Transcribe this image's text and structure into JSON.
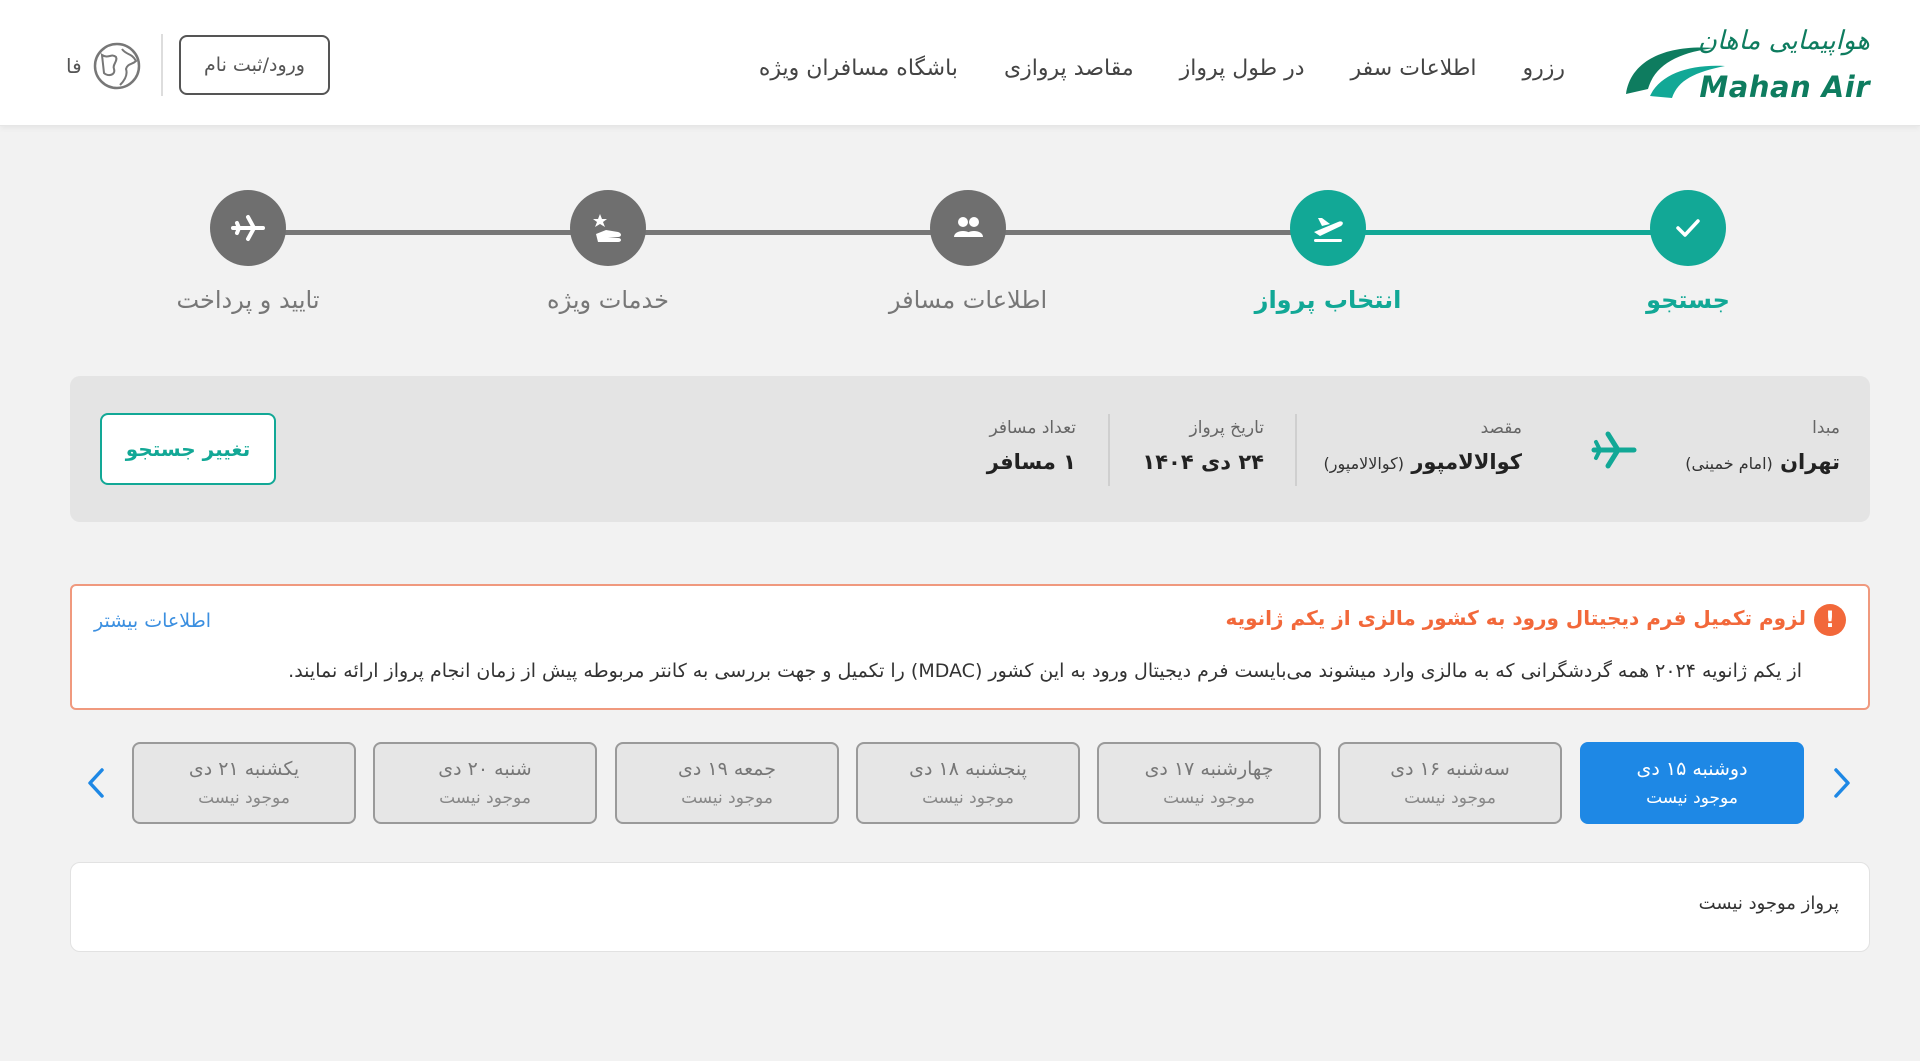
{
  "header": {
    "logo_fa": "هواپیمایی ماهان",
    "logo_en": "Mahan Air",
    "nav": [
      "رزرو",
      "اطلاعات سفر",
      "در طول پرواز",
      "مقاصد پروازی",
      "باشگاه مسافران ویژه"
    ],
    "login_label": "ورود/ثبت نام",
    "lang_label": "فا",
    "globe_icon": "globe-icon"
  },
  "stepper": {
    "steps": [
      {
        "label": "جستجو",
        "state": "done",
        "icon": "check-icon"
      },
      {
        "label": "انتخاب پرواز",
        "state": "active",
        "icon": "departure-icon"
      },
      {
        "label": "اطلاعات مسافر",
        "state": "pending",
        "icon": "passengers-icon"
      },
      {
        "label": "خدمات ویژه",
        "state": "pending",
        "icon": "special-services-icon"
      },
      {
        "label": "تایید و پرداخت",
        "state": "pending",
        "icon": "plane-icon"
      }
    ],
    "colors": {
      "done": "#12a896",
      "pending": "#6f6f6f"
    }
  },
  "summary": {
    "origin_label": "مبدا",
    "origin_value": "تهران",
    "origin_sub": "(امام خمینی)",
    "destination_label": "مقصد",
    "destination_value": "کوالالامپور",
    "destination_sub": "(کوالالامپور)",
    "date_label": "تاریخ پرواز",
    "date_value": "۲۴ دی ۱۴۰۴",
    "passengers_label": "تعداد مسافر",
    "passengers_value": "۱ مسافر",
    "change_button": "تغییر جستجو"
  },
  "notice": {
    "title": "لزوم تکمیل فرم دیجیتال ورود به کشور مالزی از یکم ژانویه",
    "more_link": "اطلاعات بیشتر",
    "body": "از یکم ژانویه ۲۰۲۴ همه گردشگرانی که به مالزی وارد میشوند می‌بایست فرم دیجیتال ورود به این کشور (MDAC) را تکمیل و جهت بررسی به کانتر مربوطه پیش از زمان انجام پرواز ارائه نمایند.",
    "accent_color": "#f2683a"
  },
  "dates": [
    {
      "day": "دوشنبه ۱۵ دی",
      "status": "موجود نیست",
      "active": true
    },
    {
      "day": "سه‌شنبه ۱۶ دی",
      "status": "موجود نیست",
      "active": false
    },
    {
      "day": "چهارشنبه ۱۷ دی",
      "status": "موجود نیست",
      "active": false
    },
    {
      "day": "پنجشنبه ۱۸ دی",
      "status": "موجود نیست",
      "active": false
    },
    {
      "day": "جمعه ۱۹ دی",
      "status": "موجود نیست",
      "active": false
    },
    {
      "day": "شنبه ۲۰ دی",
      "status": "موجود نیست",
      "active": false
    },
    {
      "day": "یکشنبه ۲۱ دی",
      "status": "موجود نیست",
      "active": false
    }
  ],
  "results": {
    "message": "پرواز موجود نیست"
  },
  "colors": {
    "brand": "#12a896",
    "active_date": "#1e88e5",
    "link": "#3b8fe0"
  }
}
